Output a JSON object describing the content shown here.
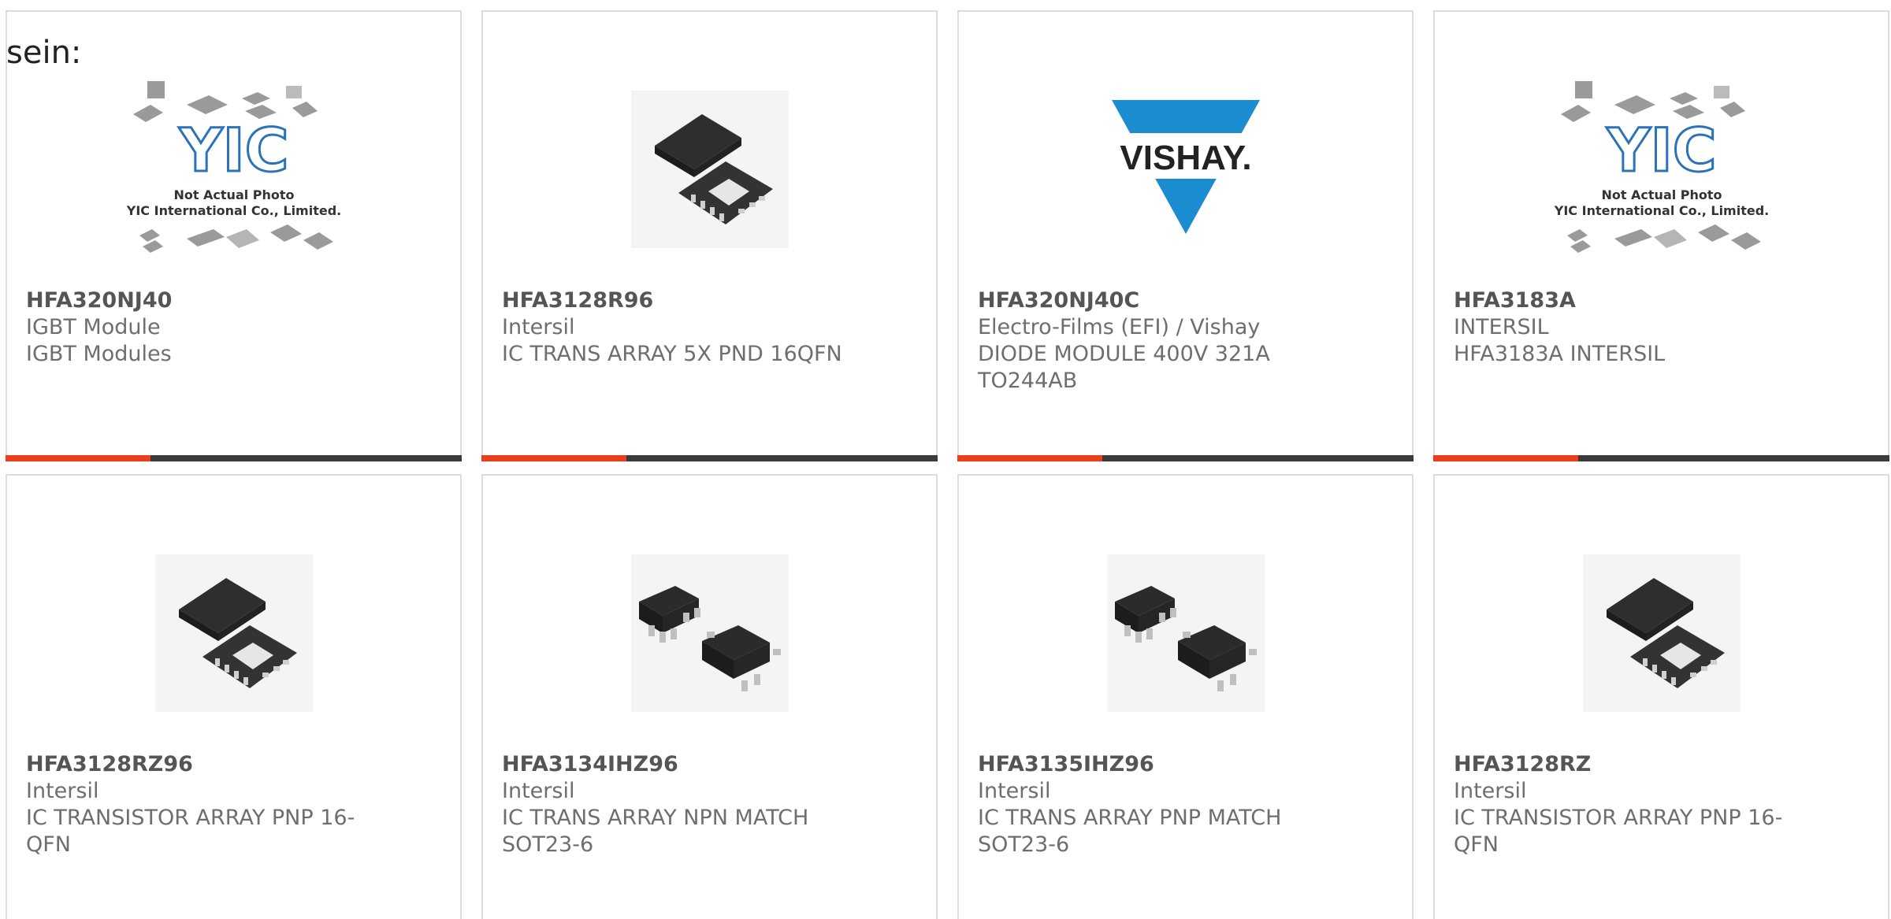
{
  "intro_text": "sein:",
  "colors": {
    "accent": "#e8401c",
    "bar": "#3a3a3a",
    "border": "#dcdcdc",
    "vishay_blue": "#1a8ccf"
  },
  "products": [
    {
      "part": "HFA320NJ40",
      "manufacturer": "IGBT Module",
      "description": "IGBT Modules",
      "image": "yic-placeholder-icon",
      "placeholder_caption_1": "Not Actual Photo",
      "placeholder_caption_2": "YIC International Co., Limited.",
      "placeholder_logo": "YIC"
    },
    {
      "part": "HFA3128R96",
      "manufacturer": "Intersil",
      "description": "IC TRANS ARRAY 5X PND 16QFN",
      "image": "qfn-chip-icon"
    },
    {
      "part": "HFA320NJ40C",
      "manufacturer": "Electro-Films (EFI) / Vishay",
      "description": "DIODE MODULE 400V 321A TO244AB",
      "image": "vishay-logo",
      "logo_text": "VISHAY."
    },
    {
      "part": "HFA3183A",
      "manufacturer": "INTERSIL",
      "description": "HFA3183A INTERSIL",
      "image": "yic-placeholder-icon",
      "placeholder_caption_1": "Not Actual Photo",
      "placeholder_caption_2": "YIC International Co., Limited.",
      "placeholder_logo": "YIC"
    },
    {
      "part": "HFA3128RZ96",
      "manufacturer": "Intersil",
      "description": "IC TRANSISTOR ARRAY PNP 16-QFN",
      "image": "qfn-chip-icon"
    },
    {
      "part": "HFA3134IHZ96",
      "manufacturer": "Intersil",
      "description": "IC TRANS ARRAY NPN MATCH SOT23-6",
      "image": "sot23-chip-icon"
    },
    {
      "part": "HFA3135IHZ96",
      "manufacturer": "Intersil",
      "description": "IC TRANS ARRAY PNP MATCH SOT23-6",
      "image": "sot23-chip-icon"
    },
    {
      "part": "HFA3128RZ",
      "manufacturer": "Intersil",
      "description": "IC TRANSISTOR ARRAY PNP 16-QFN",
      "image": "qfn-chip-icon"
    }
  ]
}
